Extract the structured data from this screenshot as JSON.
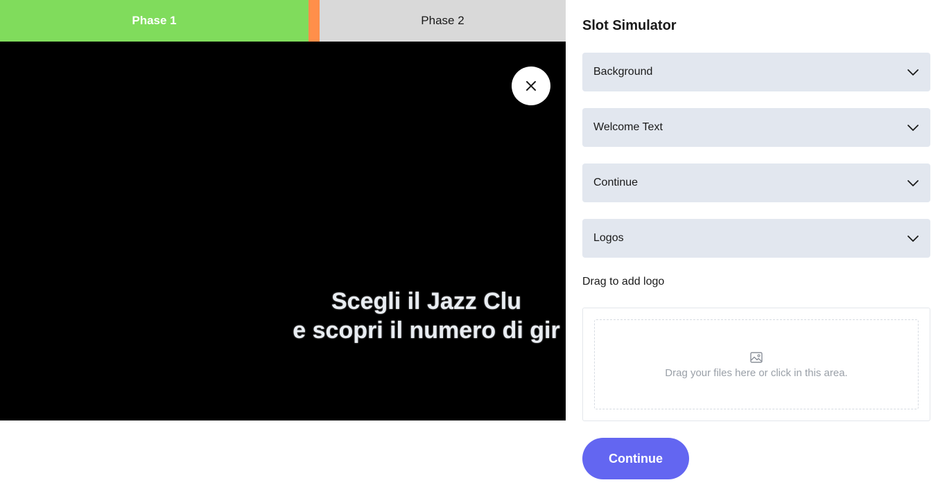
{
  "phases": {
    "phase1_label": "Phase 1",
    "phase2_label": "Phase 2",
    "phase1_color": "#80dc5c",
    "divider_color": "#ff8f4a",
    "phase2_color": "#d9d9d9"
  },
  "preview": {
    "close_icon": "close-icon",
    "welcome_line1": "Scegli il Jazz Clu",
    "welcome_line2": "e scopri il numero di gir"
  },
  "panel": {
    "title": "Slot Simulator",
    "sections": [
      {
        "label": "Background",
        "icon": "chevron-down-icon"
      },
      {
        "label": "Welcome Text",
        "icon": "chevron-down-icon"
      },
      {
        "label": "Continue",
        "icon": "chevron-down-icon"
      },
      {
        "label": "Logos",
        "icon": "chevron-down-icon"
      }
    ],
    "drag_label": "Drag to add logo",
    "upload": {
      "icon": "image-icon",
      "text": "Drag your files here or click in this area."
    },
    "continue_label": "Continue",
    "accent_color": "#6366f1"
  }
}
